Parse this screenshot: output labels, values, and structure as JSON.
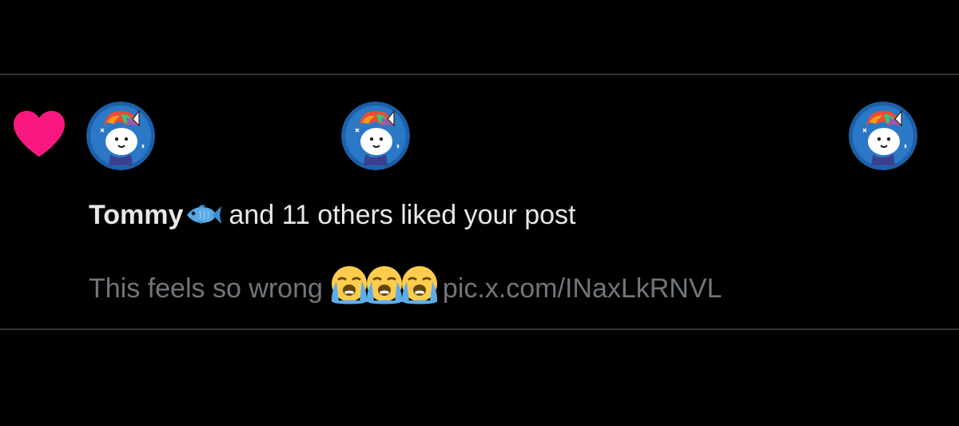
{
  "colors": {
    "background": "#000000",
    "divider": "#2f3336",
    "heart": "#f91880",
    "primary_text": "#e7e9ea",
    "secondary_text": "#71767b",
    "avatar_bg": "#1d5fa8"
  },
  "notification": {
    "type_icon": "heart-icon",
    "avatars": [
      "avatar-1",
      "avatar-2",
      "avatar-3"
    ],
    "user_name": "Tommy",
    "user_badge_emoji": "fish-emoji",
    "action_text": "and 11 others liked your post",
    "post_text": "This feels so wrong",
    "post_emojis": [
      "loudly-crying-face",
      "loudly-crying-face",
      "loudly-crying-face"
    ],
    "post_link": "pic.x.com/INaxLkRNVL"
  }
}
